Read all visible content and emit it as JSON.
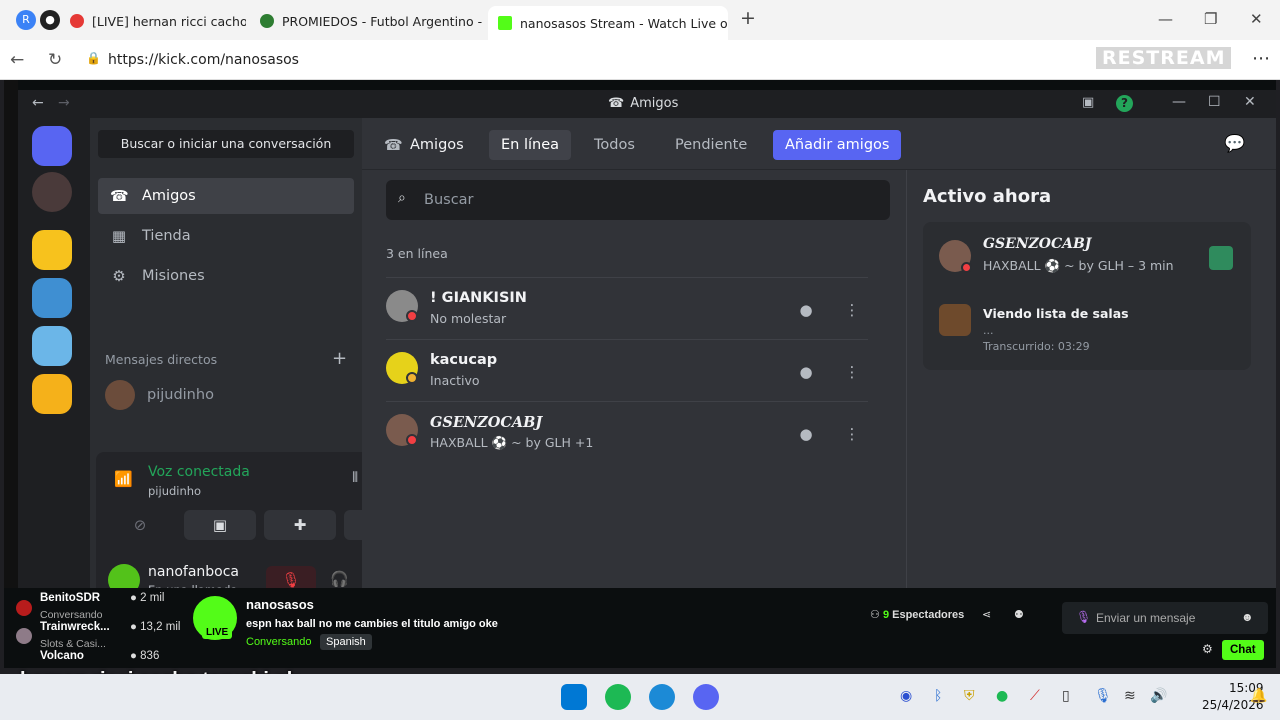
{
  "browser": {
    "tabs": [
      {
        "label": "[LIVE] hernan ricci cacho t"
      },
      {
        "label": "PROMIEDOS - Futbol Argentino - |"
      },
      {
        "label": "nanosasos Stream - Watch Live on"
      }
    ],
    "url": "https://kick.com/nanosasos",
    "watermark": "RESTREAM"
  },
  "discord": {
    "window_title": "Amigos",
    "search_conv": "Buscar o iniciar una conversación",
    "side_items": [
      {
        "label": "Amigos",
        "icon": "friends-icon"
      },
      {
        "label": "Tienda",
        "icon": "shop-icon"
      },
      {
        "label": "Misiones",
        "icon": "quests-icon"
      }
    ],
    "dm_header": "Mensajes directos",
    "dms": [
      {
        "name": "pijudinho"
      }
    ],
    "voice": {
      "title": "Voz conectada",
      "channel": "pijudinho"
    },
    "user": {
      "name": "nanofanboca",
      "status": "En una llamada"
    },
    "tabs": {
      "friends": "Amigos",
      "online": "En línea",
      "all": "Todos",
      "pending": "Pendiente",
      "add": "Añadir amigos"
    },
    "search_placeholder": "Buscar",
    "online_count": "3 en línea",
    "friends": [
      {
        "name": "! GIANKISIN",
        "status": "No molestar"
      },
      {
        "name": "GSENZOCABJ",
        "status": "HAXBALL ⚽ ~ by GLH +1"
      },
      {
        "name": "kacucap",
        "status": "Inactivo"
      }
    ],
    "active_now": {
      "title": "Activo ahora",
      "user": "GSENZOCABJ",
      "game": "HAXBALL ⚽ ~ by GLH – 3 min",
      "activity": "Viendo lista de salas",
      "activity_sub": "...",
      "elapsed": "Transcurrido: 03:29"
    },
    "colors": {
      "accent": "#5865f2",
      "online": "#23a55a",
      "dnd": "#f23f43",
      "idle": "#f0b232"
    }
  },
  "kick": {
    "recommended": [
      {
        "name": "BenitoSDR",
        "viewers": "2 mil",
        "category": "Conversando"
      },
      {
        "name": "Trainwreck...",
        "viewers": "13,2 mil",
        "category": "Slots & Casi..."
      },
      {
        "name": "Volcano",
        "viewers": "836",
        "category": ""
      }
    ],
    "streamer": "nanosasos",
    "stream_title": "espn hax ball no me cambies el titulo amigo oke",
    "live_label": "LIVE",
    "category": "Conversando",
    "language": "Spanish",
    "viewers": "9",
    "viewers_label": "Espectadores",
    "chat_placeholder": "Enviar un mensaje",
    "chat_button": "Chat"
  },
  "subtitle": "hernan ricci cacho teruchi ok",
  "taskbar": {
    "time": "15:09",
    "date": "25/4/2026"
  }
}
